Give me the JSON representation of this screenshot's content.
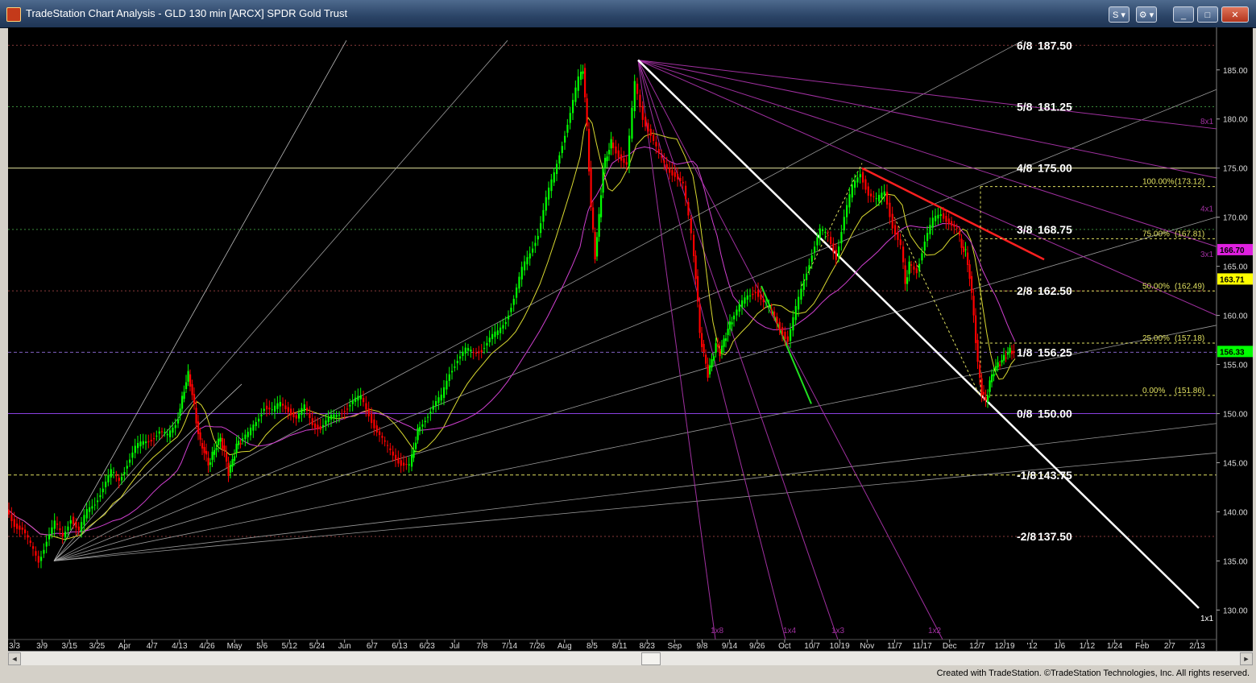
{
  "window": {
    "title": "TradeStation Chart Analysis - GLD 130 min [ARCX] SPDR Gold Trust",
    "menu_label": "S",
    "min_label": "_",
    "max_label": "□",
    "close_label": "✕"
  },
  "colors": {
    "background": "#000000",
    "up_bar": "#00ff00",
    "down_bar": "#ff0000",
    "murrey_line": "#bdbd4a",
    "gann_fan": "#9a9a9a",
    "trendline_white": "#ffffff",
    "trendline_red": "#ff2020",
    "ma_yellow": "#d9d930",
    "ma_magenta": "#d040d0",
    "price_marker_purple": "#8a60d0",
    "price_marker_yellow": "#ffff00"
  },
  "chart_data": {
    "type": "candlestick",
    "symbol": "GLD",
    "interval": "130 min",
    "exchange": "ARCX",
    "name": "SPDR Gold Trust",
    "ylim": [
      127,
      189
    ],
    "y_ticks": [
      130,
      135,
      140,
      145,
      150,
      155,
      160,
      165,
      170,
      175,
      180,
      185
    ],
    "x_tick_labels": [
      "3/3",
      "3/9",
      "3/15",
      "3/25",
      "Apr",
      "4/7",
      "4/13",
      "4/26",
      "May",
      "5/6",
      "5/12",
      "5/24",
      "Jun",
      "6/7",
      "6/13",
      "6/23",
      "Jul",
      "7/8",
      "7/14",
      "7/26",
      "Aug",
      "8/5",
      "8/11",
      "8/23",
      "Sep",
      "9/8",
      "9/14",
      "9/26",
      "Oct",
      "10/7",
      "10/19",
      "Nov",
      "11/7",
      "11/17",
      "Dec",
      "12/7",
      "12/19",
      "'12",
      "1/6",
      "1/12",
      "1/24",
      "Feb",
      "2/7",
      "2/13"
    ],
    "murrey_math_levels": [
      {
        "label": "6/8",
        "value": 187.5,
        "text": "187.50"
      },
      {
        "label": "5/8",
        "value": 181.25,
        "text": "181.25"
      },
      {
        "label": "4/8",
        "value": 175.0,
        "text": "175.00"
      },
      {
        "label": "3/8",
        "value": 168.75,
        "text": "168.75"
      },
      {
        "label": "2/8",
        "value": 162.5,
        "text": "162.50"
      },
      {
        "label": "1/8",
        "value": 156.25,
        "text": "156.25"
      },
      {
        "label": "0/8",
        "value": 150.0,
        "text": "150.00"
      },
      {
        "label": "-1/8",
        "value": 143.75,
        "text": "143.75"
      },
      {
        "label": "-2/8",
        "value": 137.5,
        "text": "137.50"
      }
    ],
    "fibonacci_retracement": [
      {
        "pct": "100.00%",
        "value": 173.12,
        "text": "(173.12)"
      },
      {
        "pct": "75.00%",
        "value": 167.81,
        "text": "(167.81)"
      },
      {
        "pct": "50.00%",
        "value": 162.49,
        "text": "(162.49)"
      },
      {
        "pct": "25.00%",
        "value": 157.18,
        "text": "(157.18)"
      },
      {
        "pct": "0.00%",
        "value": 151.86,
        "text": "(151.86)"
      }
    ],
    "axis_badges": [
      {
        "text": "166.70",
        "value": 166.7,
        "color": "#e020e0"
      },
      {
        "text": "163.71",
        "value": 163.71,
        "color": "#ffff00"
      },
      {
        "text": "156.33",
        "value": 156.33,
        "color": "#00ff00"
      }
    ],
    "gann_fan_labels": [
      "8x1",
      "4x1",
      "3x1",
      "1x8",
      "1x4",
      "1x3",
      "1x2",
      "1x1"
    ],
    "price_path": [
      [
        0,
        140.2
      ],
      [
        10,
        138.8
      ],
      [
        20,
        138.2
      ],
      [
        30,
        136.5
      ],
      [
        40,
        135.0
      ],
      [
        50,
        137.2
      ],
      [
        60,
        138.8
      ],
      [
        70,
        137.4
      ],
      [
        80,
        139.5
      ],
      [
        90,
        138.0
      ],
      [
        100,
        140.0
      ],
      [
        110,
        141.0
      ],
      [
        120,
        142.5
      ],
      [
        130,
        144.0
      ],
      [
        140,
        143.2
      ],
      [
        150,
        145.0
      ],
      [
        160,
        146.5
      ],
      [
        170,
        147.0
      ],
      [
        180,
        147.5
      ],
      [
        190,
        148.2
      ],
      [
        200,
        147.6
      ],
      [
        210,
        149.0
      ],
      [
        215,
        150.5
      ],
      [
        220,
        152.5
      ],
      [
        225,
        154.0
      ],
      [
        230,
        152.0
      ],
      [
        235,
        149.2
      ],
      [
        240,
        147.0
      ],
      [
        245,
        146.2
      ],
      [
        250,
        144.8
      ],
      [
        255,
        145.8
      ],
      [
        260,
        146.8
      ],
      [
        265,
        147.5
      ],
      [
        270,
        146.0
      ],
      [
        275,
        144.0
      ],
      [
        280,
        145.2
      ],
      [
        285,
        146.8
      ],
      [
        290,
        147.2
      ],
      [
        300,
        147.8
      ],
      [
        310,
        149.2
      ],
      [
        320,
        150.8
      ],
      [
        330,
        150.2
      ],
      [
        340,
        151.0
      ],
      [
        350,
        150.5
      ],
      [
        360,
        149.5
      ],
      [
        370,
        150.6
      ],
      [
        380,
        149.0
      ],
      [
        390,
        148.6
      ],
      [
        400,
        149.4
      ],
      [
        410,
        149.8
      ],
      [
        420,
        150.5
      ],
      [
        430,
        151.2
      ],
      [
        440,
        151.6
      ],
      [
        450,
        150.0
      ],
      [
        460,
        148.2
      ],
      [
        470,
        146.8
      ],
      [
        480,
        145.8
      ],
      [
        490,
        145.0
      ],
      [
        500,
        144.6
      ],
      [
        505,
        146.4
      ],
      [
        510,
        148.2
      ],
      [
        520,
        149.6
      ],
      [
        530,
        150.8
      ],
      [
        540,
        151.6
      ],
      [
        550,
        154.2
      ],
      [
        560,
        155.6
      ],
      [
        570,
        156.4
      ],
      [
        580,
        156.2
      ],
      [
        590,
        156.6
      ],
      [
        600,
        157.6
      ],
      [
        610,
        158.2
      ],
      [
        620,
        159.6
      ],
      [
        630,
        161.8
      ],
      [
        640,
        164.6
      ],
      [
        650,
        166.4
      ],
      [
        660,
        168.4
      ],
      [
        670,
        171.8
      ],
      [
        680,
        174.4
      ],
      [
        690,
        177.6
      ],
      [
        700,
        180.6
      ],
      [
        710,
        184.0
      ],
      [
        715,
        185.2
      ],
      [
        720,
        179.0
      ],
      [
        725,
        171.0
      ],
      [
        730,
        166.0
      ],
      [
        735,
        170.0
      ],
      [
        740,
        175.0
      ],
      [
        745,
        176.4
      ],
      [
        750,
        177.6
      ],
      [
        760,
        176.4
      ],
      [
        770,
        175.2
      ],
      [
        780,
        183.6
      ],
      [
        790,
        180.2
      ],
      [
        800,
        178.4
      ],
      [
        810,
        176.2
      ],
      [
        820,
        175.0
      ],
      [
        830,
        174.4
      ],
      [
        840,
        173.2
      ],
      [
        850,
        168.2
      ],
      [
        855,
        164.0
      ],
      [
        860,
        158.2
      ],
      [
        865,
        156.0
      ],
      [
        870,
        154.0
      ],
      [
        875,
        155.4
      ],
      [
        880,
        157.0
      ],
      [
        885,
        156.2
      ],
      [
        890,
        157.4
      ],
      [
        895,
        158.6
      ],
      [
        900,
        159.6
      ],
      [
        910,
        160.8
      ],
      [
        920,
        162.0
      ],
      [
        930,
        162.6
      ],
      [
        940,
        161.2
      ],
      [
        950,
        160.4
      ],
      [
        960,
        158.8
      ],
      [
        970,
        157.4
      ],
      [
        980,
        160.6
      ],
      [
        990,
        163.6
      ],
      [
        1000,
        166.4
      ],
      [
        1010,
        168.6
      ],
      [
        1020,
        168.0
      ],
      [
        1030,
        166.0
      ],
      [
        1040,
        170.0
      ],
      [
        1050,
        173.0
      ],
      [
        1060,
        174.6
      ],
      [
        1070,
        172.4
      ],
      [
        1080,
        171.6
      ],
      [
        1090,
        172.6
      ],
      [
        1100,
        169.2
      ],
      [
        1110,
        167.0
      ],
      [
        1115,
        163.2
      ],
      [
        1120,
        165.2
      ],
      [
        1130,
        164.6
      ],
      [
        1140,
        167.6
      ],
      [
        1150,
        169.6
      ],
      [
        1160,
        170.4
      ],
      [
        1170,
        169.6
      ],
      [
        1180,
        168.6
      ],
      [
        1185,
        167.0
      ],
      [
        1190,
        166.4
      ],
      [
        1195,
        164.0
      ],
      [
        1200,
        160.0
      ],
      [
        1205,
        155.0
      ],
      [
        1210,
        152.2
      ],
      [
        1215,
        151.2
      ],
      [
        1220,
        153.2
      ],
      [
        1225,
        154.4
      ],
      [
        1230,
        155.0
      ],
      [
        1235,
        155.4
      ],
      [
        1240,
        156.0
      ],
      [
        1245,
        156.4
      ],
      [
        1250,
        156.3
      ]
    ]
  },
  "footer": {
    "credit": "Created with TradeStation. ©TradeStation Technologies, Inc. All rights reserved."
  },
  "scrollbar": {
    "left": "◄",
    "right": "►"
  }
}
